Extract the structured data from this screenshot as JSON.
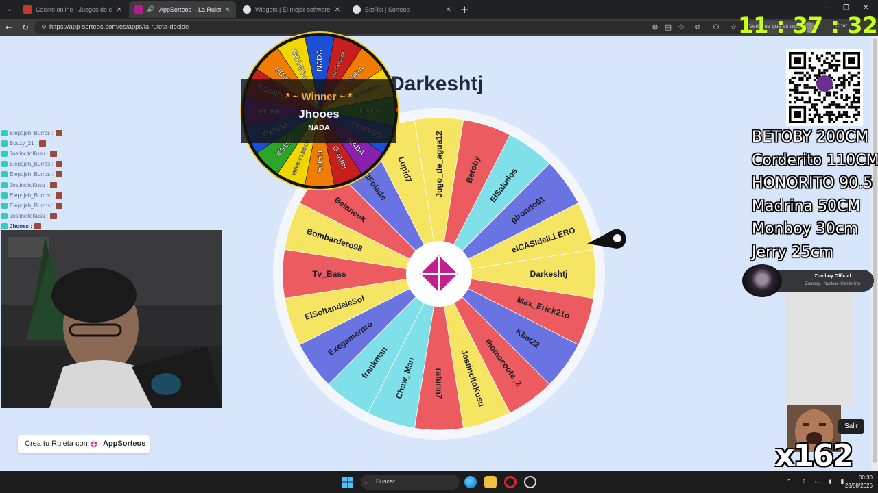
{
  "browser": {
    "tabs": [
      {
        "title": "Casino online - Juegos de casino",
        "favicon_color": "#c0392b",
        "active": false
      },
      {
        "title": "AppSorteos – La Ruleta de la",
        "favicon_color": "#b0208a",
        "active": true
      },
      {
        "title": "Widgets | El mejor software para p",
        "favicon_color": "#e0e0e0",
        "active": false
      },
      {
        "title": "BotRix | Sorteos",
        "favicon_color": "#e0e0e0",
        "active": false
      }
    ],
    "url": "https://app-sorteos.com/es/apps/la-ruleta-decide",
    "verify_text": "Verifique que es usted",
    "copilot_label": "Chat"
  },
  "clock": "11 : 37 : 32",
  "page": {
    "selected_name": "Darkeshtj",
    "brand_cta": "Crea tu Ruleta con",
    "brand_name": "AppSorteos"
  },
  "wheel": {
    "colors": {
      "yellow": "#f6e463",
      "red": "#ec5b60",
      "blue": "#6a73e2",
      "cyan": "#7fe0ea"
    },
    "segments": [
      {
        "label": "Darkeshtj",
        "color": "#f6e463"
      },
      {
        "label": "Max_Erick21o",
        "color": "#ec5b60"
      },
      {
        "label": "Kbel22",
        "color": "#6a73e2"
      },
      {
        "label": "thomocoofe_2",
        "color": "#ec5b60"
      },
      {
        "label": "JostincitoKusu",
        "color": "#f6e463"
      },
      {
        "label": "rafurin7",
        "color": "#ec5b60"
      },
      {
        "label": "Chaw_Man",
        "color": "#7fe0ea"
      },
      {
        "label": "frankman",
        "color": "#7fe0ea"
      },
      {
        "label": "Exegamerpro",
        "color": "#6a73e2"
      },
      {
        "label": "ElSoltandeleSol",
        "color": "#f6e463"
      },
      {
        "label": "Tv_Bass",
        "color": "#ec5b60"
      },
      {
        "label": "Bombardero98",
        "color": "#f6e463"
      },
      {
        "label": "Belaneuk",
        "color": "#ec5b60"
      },
      {
        "label": "ElFolade",
        "color": "#6a73e2"
      },
      {
        "label": "Lupid7",
        "color": "#f6e463"
      },
      {
        "label": "Jugo_de_agua12",
        "color": "#f6e463"
      },
      {
        "label": "Betoby",
        "color": "#ec5b60"
      },
      {
        "label": "ElSaludos",
        "color": "#7fe0ea"
      },
      {
        "label": "girondo01",
        "color": "#6a73e2"
      },
      {
        "label": "elCASIdeILLERO",
        "color": "#f6e463"
      }
    ]
  },
  "mini_wheel": {
    "segments": [
      {
        "label": "NADA",
        "color": "#1a4fd6"
      },
      {
        "label": "100 PUNTOS",
        "color": "#c81e1e"
      },
      {
        "label": "NADA",
        "color": "#f07d00"
      },
      {
        "label": "10 PUNTOS",
        "color": "#f2d600"
      },
      {
        "label": "NADA",
        "color": "#2aa52a"
      },
      {
        "label": "PUNTOS",
        "color": "#1a4fd6"
      },
      {
        "label": "NADA",
        "color": "#8a20b0"
      },
      {
        "label": "GAMPI",
        "color": "#c81e1e"
      },
      {
        "label": "NADA",
        "color": "#f07d00"
      },
      {
        "label": "SO DE LA MAMA",
        "color": "#f2d600"
      },
      {
        "label": "NADA",
        "color": "#2aa52a"
      },
      {
        "label": "PUNTOS",
        "color": "#1a4fd6"
      },
      {
        "label": "NADA",
        "color": "#8a20b0"
      },
      {
        "label": "PUNTOS",
        "color": "#c81e1e"
      },
      {
        "label": "NADA",
        "color": "#f07d00"
      },
      {
        "label": "PUNTOS",
        "color": "#f2d600"
      }
    ]
  },
  "winner": {
    "title": "* ~ Winner ~ *",
    "name": "Jhooes",
    "prize": "NADA"
  },
  "chat": {
    "rows": [
      {
        "name": "Elepojeh_Burros :",
        "highlight": false
      },
      {
        "name": "Bouzy_21 :",
        "highlight": false
      },
      {
        "name": "JostincitoKusu :",
        "highlight": false
      },
      {
        "name": "Elepojeh_Burros :",
        "highlight": false
      },
      {
        "name": "Elepojeh_Burros :",
        "highlight": false
      },
      {
        "name": "JostincitoKusu :",
        "highlight": false
      },
      {
        "name": "Elepojeh_Burros :",
        "highlight": false
      },
      {
        "name": "Elepojeh_Burros :",
        "highlight": false
      },
      {
        "name": "JostincitoKusu :",
        "highlight": false
      },
      {
        "name": "Jhooes :",
        "highlight": true
      }
    ]
  },
  "donors": [
    "BETOBY 200CM",
    "Corderito 110CM",
    "HONORITO 90.5",
    "Madrina 50CM",
    "Monboy 30cm",
    "Jerry 25cm"
  ],
  "music": {
    "artist": "Zomboy Official",
    "song": "Zomboy - Nuclear (Hands Up)"
  },
  "salir_label": "Salir",
  "multiplier": "x162",
  "taskbar": {
    "search_label": "Buscar",
    "time": "00:30",
    "date": "28/08/2026"
  }
}
